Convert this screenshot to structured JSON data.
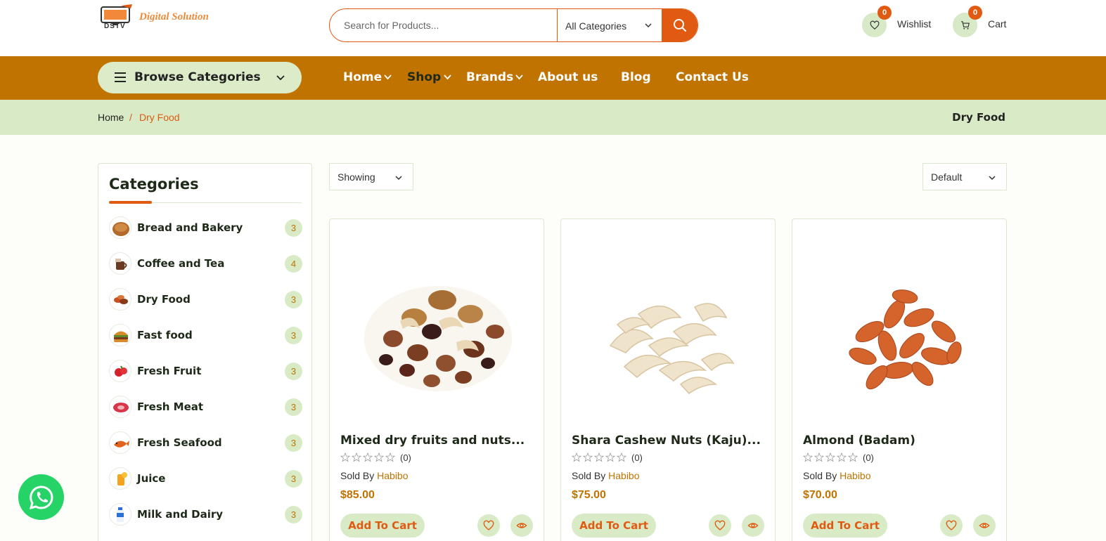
{
  "header": {
    "logo_text": "Digital Solution",
    "logo_sub": "DSTV",
    "search_placeholder": "Search for Products...",
    "category_select": "All Categories",
    "wishlist": {
      "label": "Wishlist",
      "count": "0"
    },
    "cart": {
      "label": "Cart",
      "count": "0"
    }
  },
  "nav": {
    "browse_label": "Browse Categories",
    "items": [
      {
        "label": "Home",
        "has_dropdown": true
      },
      {
        "label": "Shop",
        "has_dropdown": true,
        "active": true
      },
      {
        "label": "Brands",
        "has_dropdown": true
      },
      {
        "label": "About us",
        "has_dropdown": false
      },
      {
        "label": "Blog",
        "has_dropdown": false
      },
      {
        "label": "Contact Us",
        "has_dropdown": false
      }
    ]
  },
  "breadcrumb": {
    "home": "Home",
    "separator": "/",
    "current": "Dry Food",
    "page_title": "Dry Food"
  },
  "sidebar": {
    "title": "Categories",
    "categories": [
      {
        "name": "Bread and Bakery",
        "count": "3"
      },
      {
        "name": "Coffee and Tea",
        "count": "4"
      },
      {
        "name": "Dry Food",
        "count": "3"
      },
      {
        "name": "Fast food",
        "count": "3"
      },
      {
        "name": "Fresh Fruit",
        "count": "3"
      },
      {
        "name": "Fresh Meat",
        "count": "3"
      },
      {
        "name": "Fresh Seafood",
        "count": "3"
      },
      {
        "name": "Juice",
        "count": "3"
      },
      {
        "name": "Milk and Dairy",
        "count": "3"
      }
    ]
  },
  "toolbar": {
    "showing_label": "Showing",
    "sort_label": "Default"
  },
  "products": [
    {
      "name": "Mixed dry fruits and nuts...",
      "rating": "(0)",
      "sold_by": "Sold By",
      "vendor": "Habibo",
      "price": "$85.00",
      "add_label": "Add To Cart"
    },
    {
      "name": "Shara Cashew Nuts (Kaju)...",
      "rating": "(0)",
      "sold_by": "Sold By",
      "vendor": "Habibo",
      "price": "$75.00",
      "add_label": "Add To Cart"
    },
    {
      "name": "Almond (Badam)",
      "rating": "(0)",
      "sold_by": "Sold By",
      "vendor": "Habibo",
      "price": "$70.00",
      "add_label": "Add To Cart"
    }
  ],
  "colors": {
    "accent": "#e05a12",
    "nav_bg": "#c17300",
    "soft_green": "#d8ebc6",
    "whatsapp": "#25d366"
  }
}
